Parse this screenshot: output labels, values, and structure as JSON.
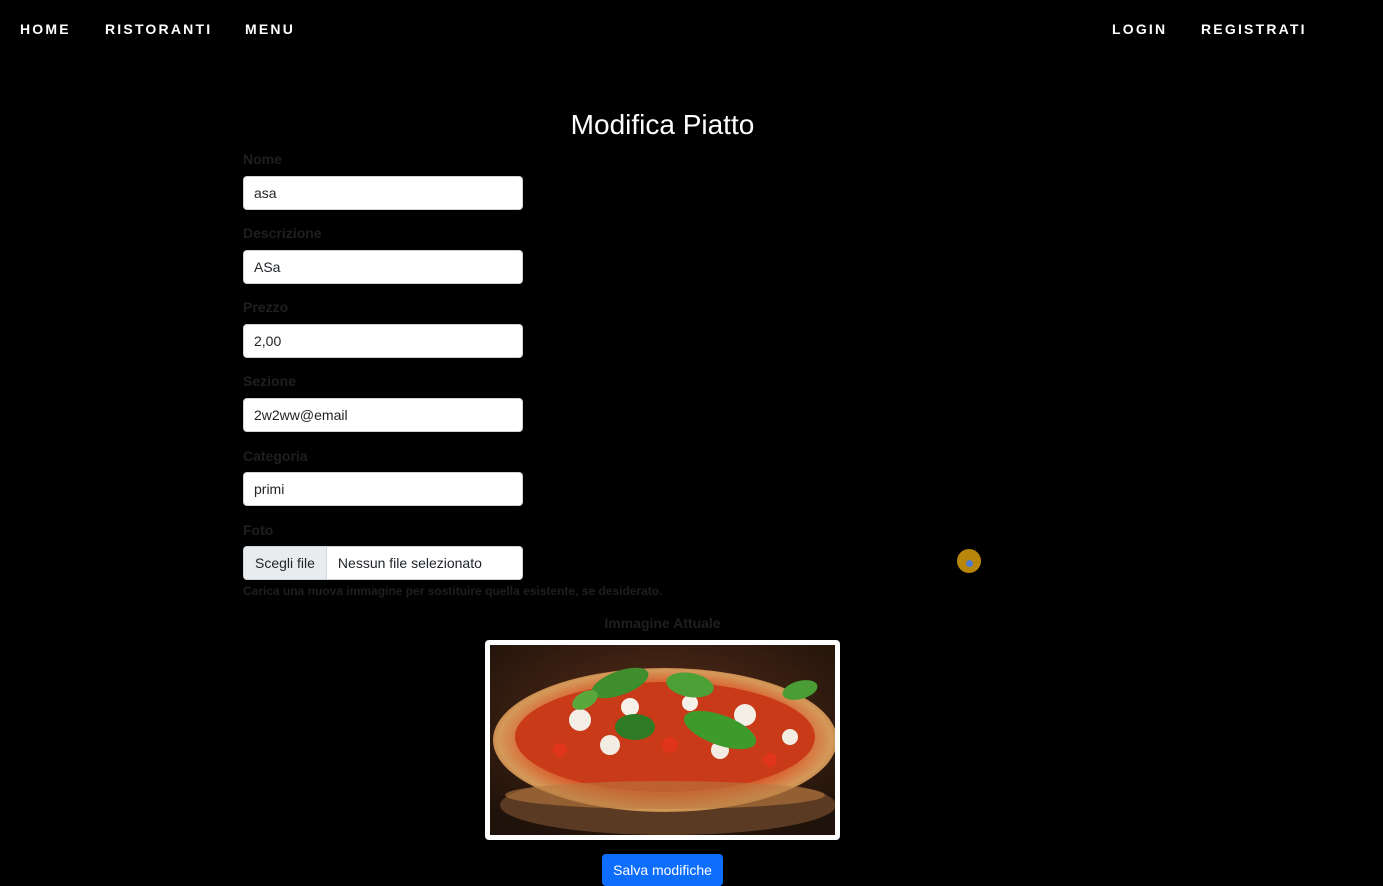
{
  "nav": {
    "home": "HOME",
    "ristoranti": "RISTORANTI",
    "menu": "MENU",
    "login": "LOGIN",
    "registrati": "REGISTRATI"
  },
  "page": {
    "title": "Modifica Piatto"
  },
  "form": {
    "nome": {
      "label": "Nome",
      "value": "asa"
    },
    "descrizione": {
      "label": "Descrizione",
      "value": "ASa"
    },
    "prezzo": {
      "label": "Prezzo",
      "value": "2,00"
    },
    "sezione": {
      "label": "Sezione",
      "value": "2w2ww@email"
    },
    "categoria": {
      "label": "Categoria",
      "value": "primi"
    },
    "foto": {
      "label": "Foto",
      "button_label": "Scegli file",
      "file_status": "Nessun file selezionato",
      "help_text": "Carica una nuova immagine per sostituire quella esistente, se desiderato."
    },
    "current_image_label": "Immagine Attuale",
    "current_image_icon": "pizza-photo",
    "save_label": "Salva modifiche"
  },
  "colors": {
    "background": "#000000",
    "label_text": "#1f1f1f",
    "primary_button": "#0d6efd"
  }
}
